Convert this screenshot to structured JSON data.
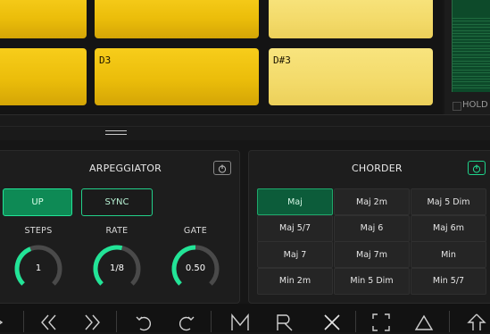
{
  "pads": [
    {
      "label": "",
      "style": "gold"
    },
    {
      "label": "",
      "style": "gold"
    },
    {
      "label": "",
      "style": "light"
    },
    {
      "label": "",
      "style": "gold"
    },
    {
      "label": "D3",
      "style": "gold"
    },
    {
      "label": "D#3",
      "style": "light"
    }
  ],
  "side": {
    "hold_label": "HOLD"
  },
  "arpeggiator": {
    "title": "ARPEGGIATOR",
    "power": "off",
    "mode_button": "UP",
    "sync_button": "SYNC",
    "knobs": [
      {
        "label": "STEPS",
        "value": "1",
        "level": 0.42
      },
      {
        "label": "RATE",
        "value": "1/8",
        "level": 0.55
      },
      {
        "label": "GATE",
        "value": "0.50",
        "level": 0.5
      }
    ]
  },
  "chorder": {
    "title": "CHORDER",
    "power": "on",
    "selected": "Maj",
    "chords": [
      "Maj",
      "Maj 2m",
      "Maj 5 Dim",
      "Maj 5/7",
      "Maj 6",
      "Maj 6m",
      "Maj 7",
      "Maj 7m",
      "Min",
      "Min 2m",
      "Min 5 Dim",
      "Min 5/7"
    ]
  },
  "toolbar": {
    "icons": [
      "play-icon",
      "rewind-icon",
      "fast-forward-icon",
      "undo-icon",
      "redo-icon",
      "m-mode-icon",
      "r-mode-icon",
      "close-icon",
      "fullscreen-icon",
      "triangle-icon",
      "shift-up-icon"
    ]
  },
  "colors": {
    "accent": "#22e497",
    "pad_gold": "#f2c412",
    "pad_light": "#f3da69",
    "background": "#161616"
  }
}
